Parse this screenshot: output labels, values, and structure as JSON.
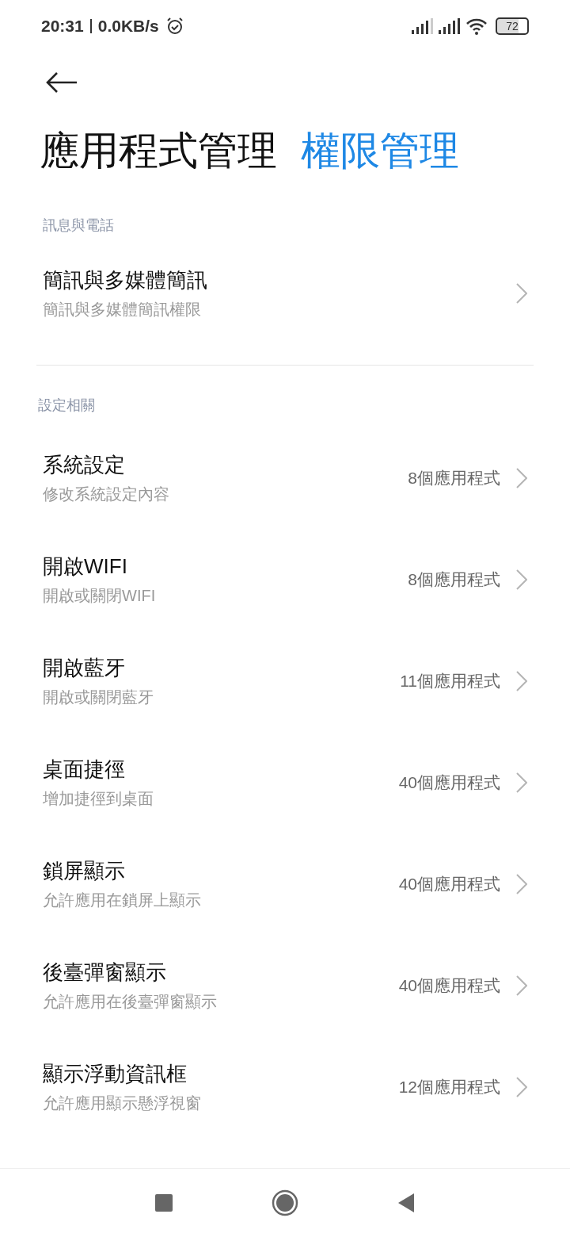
{
  "status_bar": {
    "time": "20:31",
    "speed": "0.0KB/s",
    "battery": "72"
  },
  "header": {
    "title": "應用程式管理",
    "subtitle": "權限管理"
  },
  "sections": [
    {
      "title": "訊息與電話",
      "items": [
        {
          "title": "簡訊與多媒體簡訊",
          "description": "簡訊與多媒體簡訊權限"
        }
      ]
    },
    {
      "title": "設定相關",
      "items": [
        {
          "title": "系統設定",
          "description": "修改系統設定內容",
          "count": "8個應用程式"
        },
        {
          "title": "開啟WIFI",
          "description": "開啟或關閉WIFI",
          "count": "8個應用程式"
        },
        {
          "title": "開啟藍牙",
          "description": "開啟或關閉藍牙",
          "count": "11個應用程式"
        },
        {
          "title": "桌面捷徑",
          "description": "增加捷徑到桌面",
          "count": "40個應用程式"
        },
        {
          "title": "鎖屏顯示",
          "description": "允許應用在鎖屏上顯示",
          "count": "40個應用程式"
        },
        {
          "title": "後臺彈窗顯示",
          "description": "允許應用在後臺彈窗顯示",
          "count": "40個應用程式"
        },
        {
          "title": "顯示浮動資訊框",
          "description": "允許應用顯示懸浮視窗",
          "count": "12個應用程式"
        }
      ]
    }
  ]
}
